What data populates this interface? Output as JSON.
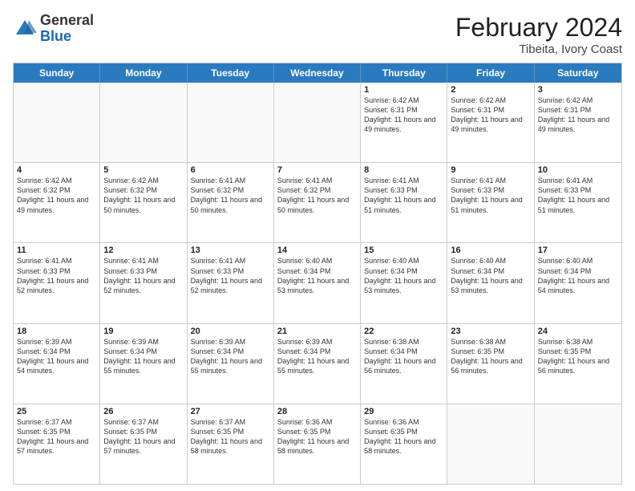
{
  "header": {
    "logo_general": "General",
    "logo_blue": "Blue",
    "title": "February 2024",
    "subtitle": "Tibeita, Ivory Coast"
  },
  "days_of_week": [
    "Sunday",
    "Monday",
    "Tuesday",
    "Wednesday",
    "Thursday",
    "Friday",
    "Saturday"
  ],
  "weeks": [
    [
      {
        "day": "",
        "text": "",
        "empty": true
      },
      {
        "day": "",
        "text": "",
        "empty": true
      },
      {
        "day": "",
        "text": "",
        "empty": true
      },
      {
        "day": "",
        "text": "",
        "empty": true
      },
      {
        "day": "1",
        "text": "Sunrise: 6:42 AM\nSunset: 6:31 PM\nDaylight: 11 hours\nand 49 minutes.",
        "empty": false
      },
      {
        "day": "2",
        "text": "Sunrise: 6:42 AM\nSunset: 6:31 PM\nDaylight: 11 hours\nand 49 minutes.",
        "empty": false
      },
      {
        "day": "3",
        "text": "Sunrise: 6:42 AM\nSunset: 6:31 PM\nDaylight: 11 hours\nand 49 minutes.",
        "empty": false
      }
    ],
    [
      {
        "day": "4",
        "text": "Sunrise: 6:42 AM\nSunset: 6:32 PM\nDaylight: 11 hours\nand 49 minutes.",
        "empty": false
      },
      {
        "day": "5",
        "text": "Sunrise: 6:42 AM\nSunset: 6:32 PM\nDaylight: 11 hours\nand 50 minutes.",
        "empty": false
      },
      {
        "day": "6",
        "text": "Sunrise: 6:41 AM\nSunset: 6:32 PM\nDaylight: 11 hours\nand 50 minutes.",
        "empty": false
      },
      {
        "day": "7",
        "text": "Sunrise: 6:41 AM\nSunset: 6:32 PM\nDaylight: 11 hours\nand 50 minutes.",
        "empty": false
      },
      {
        "day": "8",
        "text": "Sunrise: 6:41 AM\nSunset: 6:33 PM\nDaylight: 11 hours\nand 51 minutes.",
        "empty": false
      },
      {
        "day": "9",
        "text": "Sunrise: 6:41 AM\nSunset: 6:33 PM\nDaylight: 11 hours\nand 51 minutes.",
        "empty": false
      },
      {
        "day": "10",
        "text": "Sunrise: 6:41 AM\nSunset: 6:33 PM\nDaylight: 11 hours\nand 51 minutes.",
        "empty": false
      }
    ],
    [
      {
        "day": "11",
        "text": "Sunrise: 6:41 AM\nSunset: 6:33 PM\nDaylight: 11 hours\nand 52 minutes.",
        "empty": false
      },
      {
        "day": "12",
        "text": "Sunrise: 6:41 AM\nSunset: 6:33 PM\nDaylight: 11 hours\nand 52 minutes.",
        "empty": false
      },
      {
        "day": "13",
        "text": "Sunrise: 6:41 AM\nSunset: 6:33 PM\nDaylight: 11 hours\nand 52 minutes.",
        "empty": false
      },
      {
        "day": "14",
        "text": "Sunrise: 6:40 AM\nSunset: 6:34 PM\nDaylight: 11 hours\nand 53 minutes.",
        "empty": false
      },
      {
        "day": "15",
        "text": "Sunrise: 6:40 AM\nSunset: 6:34 PM\nDaylight: 11 hours\nand 53 minutes.",
        "empty": false
      },
      {
        "day": "16",
        "text": "Sunrise: 6:40 AM\nSunset: 6:34 PM\nDaylight: 11 hours\nand 53 minutes.",
        "empty": false
      },
      {
        "day": "17",
        "text": "Sunrise: 6:40 AM\nSunset: 6:34 PM\nDaylight: 11 hours\nand 54 minutes.",
        "empty": false
      }
    ],
    [
      {
        "day": "18",
        "text": "Sunrise: 6:39 AM\nSunset: 6:34 PM\nDaylight: 11 hours\nand 54 minutes.",
        "empty": false
      },
      {
        "day": "19",
        "text": "Sunrise: 6:39 AM\nSunset: 6:34 PM\nDaylight: 11 hours\nand 55 minutes.",
        "empty": false
      },
      {
        "day": "20",
        "text": "Sunrise: 6:39 AM\nSunset: 6:34 PM\nDaylight: 11 hours\nand 55 minutes.",
        "empty": false
      },
      {
        "day": "21",
        "text": "Sunrise: 6:39 AM\nSunset: 6:34 PM\nDaylight: 11 hours\nand 55 minutes.",
        "empty": false
      },
      {
        "day": "22",
        "text": "Sunrise: 6:38 AM\nSunset: 6:34 PM\nDaylight: 11 hours\nand 56 minutes.",
        "empty": false
      },
      {
        "day": "23",
        "text": "Sunrise: 6:38 AM\nSunset: 6:35 PM\nDaylight: 11 hours\nand 56 minutes.",
        "empty": false
      },
      {
        "day": "24",
        "text": "Sunrise: 6:38 AM\nSunset: 6:35 PM\nDaylight: 11 hours\nand 56 minutes.",
        "empty": false
      }
    ],
    [
      {
        "day": "25",
        "text": "Sunrise: 6:37 AM\nSunset: 6:35 PM\nDaylight: 11 hours\nand 57 minutes.",
        "empty": false
      },
      {
        "day": "26",
        "text": "Sunrise: 6:37 AM\nSunset: 6:35 PM\nDaylight: 11 hours\nand 57 minutes.",
        "empty": false
      },
      {
        "day": "27",
        "text": "Sunrise: 6:37 AM\nSunset: 6:35 PM\nDaylight: 11 hours\nand 58 minutes.",
        "empty": false
      },
      {
        "day": "28",
        "text": "Sunrise: 6:36 AM\nSunset: 6:35 PM\nDaylight: 11 hours\nand 58 minutes.",
        "empty": false
      },
      {
        "day": "29",
        "text": "Sunrise: 6:36 AM\nSunset: 6:35 PM\nDaylight: 11 hours\nand 58 minutes.",
        "empty": false
      },
      {
        "day": "",
        "text": "",
        "empty": true
      },
      {
        "day": "",
        "text": "",
        "empty": true
      }
    ]
  ]
}
